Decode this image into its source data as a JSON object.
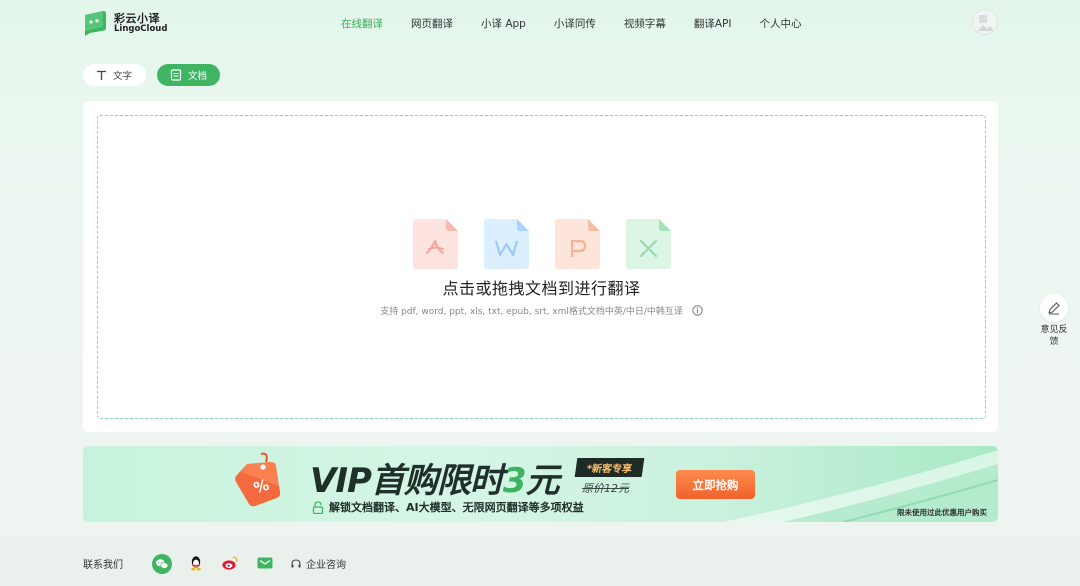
{
  "header": {
    "logo_cn": "彩云小译",
    "logo_en": "LingoCloud",
    "nav": [
      {
        "label": "在线翻译",
        "active": true
      },
      {
        "label": "网页翻译",
        "active": false
      },
      {
        "label": "小译 App",
        "active": false
      },
      {
        "label": "小译同传",
        "active": false
      },
      {
        "label": "视频字幕",
        "active": false
      },
      {
        "label": "翻译API",
        "active": false
      },
      {
        "label": "个人中心",
        "active": false
      }
    ]
  },
  "tabs": {
    "text_label": "文字",
    "doc_label": "文档",
    "active": "doc"
  },
  "upload": {
    "title": "点击或拖拽文档到进行翻译",
    "subtitle": "支持 pdf, word, ppt, xls, txt, epub, srt, xml格式文档中英/中日/中韩互译",
    "file_icons": [
      "pdf-icon",
      "word-icon",
      "ppt-icon",
      "excel-icon"
    ]
  },
  "banner": {
    "title_prefix": "VIP首购限时",
    "title_number": "3",
    "title_suffix": "元",
    "badge": "*新客专享",
    "original_price": "原价12元",
    "button": "立即抢购",
    "subtitle": "解锁文档翻译、AI大模型、无限网页翻译等多项权益",
    "note": "限未使用过此优惠用户购买"
  },
  "feedback": {
    "label": "意见反馈"
  },
  "footer": {
    "contact_label": "联系我们",
    "social": [
      "wechat-icon",
      "qq-icon",
      "weibo-icon",
      "email-icon"
    ],
    "consult_label": "企业咨询"
  },
  "colors": {
    "brand_green": "#3fb564",
    "nav_active": "#3cae5c",
    "buy_orange": "#f0622b"
  }
}
